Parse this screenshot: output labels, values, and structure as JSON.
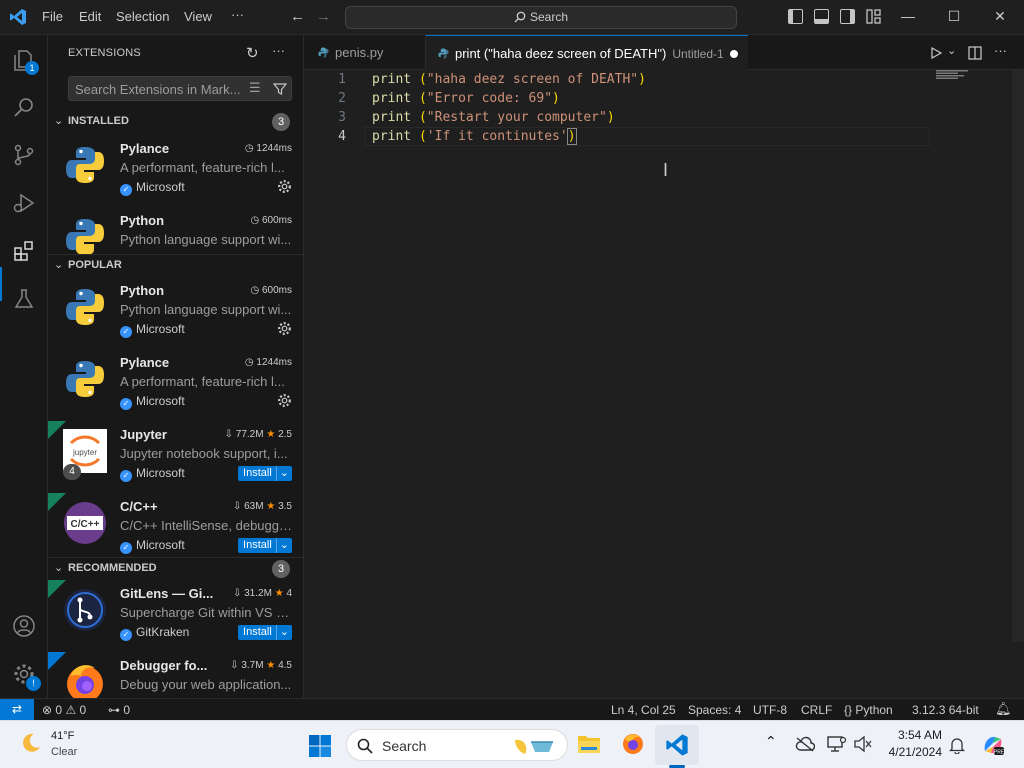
{
  "titlebar": {
    "menus": [
      "File",
      "Edit",
      "Selection",
      "View",
      "···"
    ],
    "command_center": "Search"
  },
  "activitybar": {
    "explorer_badge": "1"
  },
  "sidebar": {
    "title": "EXTENSIONS",
    "search_placeholder": "Search Extensions in Mark...",
    "installed": {
      "label": "INSTALLED",
      "count": "3",
      "items": [
        {
          "name": "Pylance",
          "stat": "1244ms",
          "desc": "A performant, feature-rich l...",
          "publisher": "Microsoft"
        },
        {
          "name": "Python",
          "stat": "600ms",
          "desc": "Python language support wi...",
          "publisher": ""
        }
      ]
    },
    "popular": {
      "label": "POPULAR",
      "items": [
        {
          "name": "Python",
          "stat": "600ms",
          "desc": "Python language support wi...",
          "publisher": "Microsoft"
        },
        {
          "name": "Pylance",
          "stat": "1244ms",
          "desc": "A performant, feature-rich l...",
          "publisher": "Microsoft"
        },
        {
          "name": "Jupyter",
          "downloads": "77.2M",
          "rating": "2.5",
          "desc": "Jupyter notebook support, i...",
          "publisher": "Microsoft",
          "install": "Install",
          "badge": "4"
        },
        {
          "name": "C/C++",
          "downloads": "63M",
          "rating": "3.5",
          "desc": "C/C++ IntelliSense, debuggi...",
          "publisher": "Microsoft",
          "install": "Install"
        }
      ]
    },
    "recommended": {
      "label": "RECOMMENDED",
      "count": "3",
      "items": [
        {
          "name": "GitLens — Gi...",
          "downloads": "31.2M",
          "rating": "4",
          "desc": "Supercharge Git within VS C...",
          "publisher": "GitKraken",
          "install": "Install"
        },
        {
          "name": "Debugger fo...",
          "downloads": "3.7M",
          "rating": "4.5",
          "desc": "Debug your web application..."
        }
      ]
    }
  },
  "tabs": [
    {
      "label": "penis.py"
    },
    {
      "label": "print (\"haha deez screen of DEATH\")",
      "sub": "Untitled-1"
    }
  ],
  "editor": {
    "line_numbers": [
      "1",
      "2",
      "3",
      "4"
    ],
    "lines": [
      {
        "kw": "print",
        "open": " (",
        "str": "\"haha deez screen of DEATH\"",
        "close": ")"
      },
      {
        "kw": "print",
        "open": " (",
        "str": "\"Error code: 69\"",
        "close": ")"
      },
      {
        "kw": "print",
        "open": " (",
        "str": "\"Restart your computer\"",
        "close": ")"
      },
      {
        "kw": "print",
        "open": " (",
        "str": "'If it continutes'",
        "close": ")"
      }
    ]
  },
  "statusbar": {
    "errors": "0",
    "warnings": "0",
    "ports": "0",
    "position": "Ln 4, Col 25",
    "spaces": "Spaces: 4",
    "encoding": "UTF-8",
    "eol": "CRLF",
    "language": "Python",
    "interpreter": "3.12.3 64-bit"
  },
  "taskbar": {
    "temperature": "41°F",
    "condition": "Clear",
    "search": "Search",
    "time": "3:54 AM",
    "date": "4/21/2024"
  },
  "colors": {
    "accent": "#0078d4",
    "editor_bg": "#1f1f1f",
    "sidebar_bg": "#181818",
    "string": "#ce9178",
    "function": "#dcdcaa"
  }
}
